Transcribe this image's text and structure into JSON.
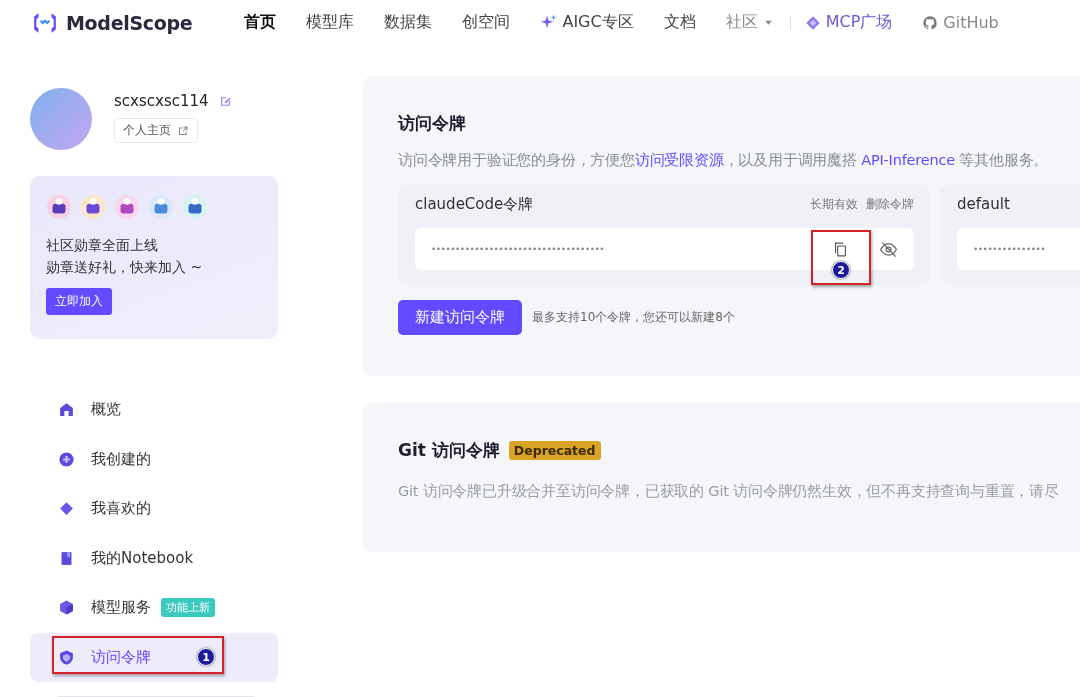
{
  "header": {
    "logo": "ModelScope",
    "nav": [
      {
        "label": "首页",
        "selected": true,
        "kind": "plain"
      },
      {
        "label": "模型库",
        "selected": false,
        "kind": "plain"
      },
      {
        "label": "数据集",
        "selected": false,
        "kind": "plain"
      },
      {
        "label": "创空间",
        "selected": false,
        "kind": "plain"
      },
      {
        "label": "AIGC专区",
        "selected": false,
        "kind": "sparkle"
      },
      {
        "label": "文档",
        "selected": false,
        "kind": "plain"
      },
      {
        "label": "社区",
        "selected": false,
        "kind": "dropdown"
      },
      {
        "label": "MCP广场",
        "selected": false,
        "kind": "mcp"
      },
      {
        "label": "GitHub",
        "selected": false,
        "kind": "github"
      }
    ]
  },
  "profile": {
    "username": "scxscxsc114",
    "homepage_button": "个人主页"
  },
  "promo": {
    "lines": [
      "社区勋章全面上线",
      "勋章送好礼，快来加入 ~"
    ],
    "button": "立即加入"
  },
  "sidebar": {
    "items": [
      {
        "label": "概览",
        "selected": false,
        "kind": "home"
      },
      {
        "label": "我创建的",
        "selected": false,
        "kind": "plus"
      },
      {
        "label": "我喜欢的",
        "selected": false,
        "kind": "diamond"
      },
      {
        "label": "我的Notebook",
        "selected": false,
        "kind": "book"
      },
      {
        "label": "模型服务",
        "selected": false,
        "kind": "cube",
        "badge": "功能上新"
      },
      {
        "label": "访问令牌",
        "selected": true,
        "kind": "shield",
        "callout": "1"
      }
    ]
  },
  "access_tokens": {
    "title": "访问令牌",
    "description": [
      {
        "text": "访问令牌用于验证您的身份，方便您",
        "link": false
      },
      {
        "text": "访问受限资源",
        "link": true
      },
      {
        "text": "，以及用于调用魔搭 ",
        "link": false
      },
      {
        "text": "API-Inference",
        "link": true
      },
      {
        "text": " 等其他服务。",
        "link": false
      }
    ],
    "tokens": [
      {
        "name": "claudeCode令牌",
        "validity": "长期有效",
        "delete": "删除令牌",
        "masked": "••••••••••••••••••••••••••••••••••••",
        "callout": "2"
      },
      {
        "name": "default",
        "masked": "•••••••••••••••"
      }
    ],
    "new_button": "新建访问令牌",
    "limit_note": "最多支持10个令牌，您还可以新建8个"
  },
  "git_tokens": {
    "title": "Git 访问令牌",
    "tag": "Deprecated",
    "description": "Git 访问令牌已升级合并至访问令牌，已获取的 Git 访问令牌仍然生效，但不再支持查询与重置，请尽"
  }
}
